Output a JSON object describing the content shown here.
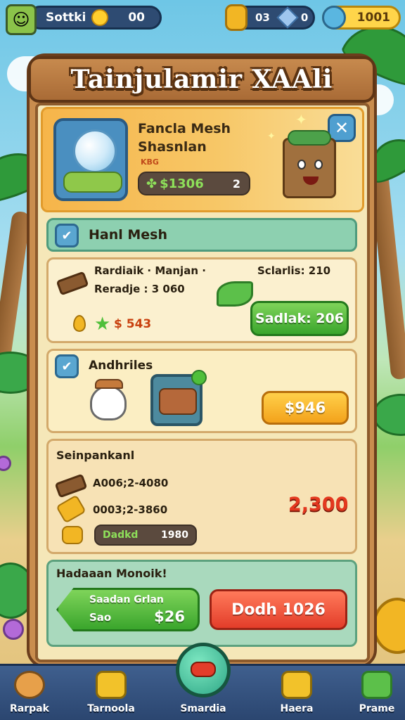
{
  "hud": {
    "player_name": "Sottki",
    "coins_left": "00",
    "resource_a": "03",
    "resource_b": "0",
    "gold": "1001"
  },
  "panel": {
    "title": "Tainjulamir XAAli",
    "item": {
      "name_line1": "Fancla Mesh",
      "name_line2": "Shasnlan",
      "tag": "KBG",
      "price": "$1306",
      "qty": "2"
    },
    "section1": {
      "title": "Hanl Mesh",
      "row1_left": "Rardiaik · Manjan ·",
      "row1_right": "Sclarlis: 210",
      "row2_left": "Reradje : 3 060",
      "cost": "$ 543",
      "button": "Sadlak: 206"
    },
    "section2": {
      "title": "Andhriles",
      "button": "$946"
    },
    "section3": {
      "title": "Seinpankanl",
      "line1": "A006;2-4080",
      "line2": "0003;2-3860",
      "tag_label": "Dadkd",
      "tag_value": "1980",
      "total": "2,300"
    },
    "section4": {
      "title": "Hadaaan Monoik!",
      "green_line1": "Saadan Grlan",
      "green_line2_left": "Sao",
      "green_line2_right": "$26",
      "red_button": "Dodh 1026"
    }
  },
  "nav": [
    {
      "label": "Rarpak"
    },
    {
      "label": "Tarnoola"
    },
    {
      "label": "Smardia"
    },
    {
      "label": "Haera"
    },
    {
      "label": "Prame"
    }
  ],
  "colors": {
    "accent_green": "#3aa52c",
    "accent_orange": "#f3a21b",
    "accent_red": "#e33d2a",
    "wood": "#a96b36"
  }
}
